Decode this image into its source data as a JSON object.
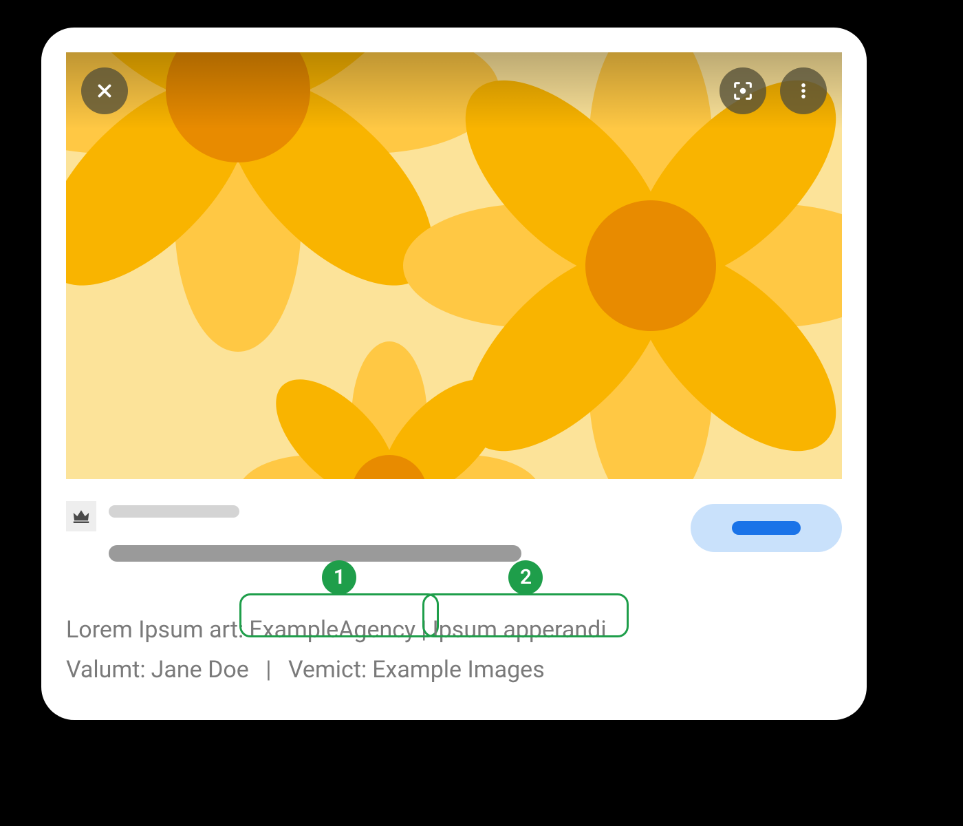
{
  "credits": {
    "line1": {
      "label": "Lorem Ipsum art:",
      "agency": "ExampleAgency",
      "separator": "|",
      "extra": "Ipsum apperandi"
    },
    "line2": {
      "creator_label": "Valumt:",
      "creator_value": "Jane Doe",
      "separator": "|",
      "credit_label": "Vemict:",
      "credit_value": "Example Images"
    }
  },
  "callouts": {
    "one": "1",
    "two": "2"
  },
  "icons": {
    "close": "close-icon",
    "lens": "lens-icon",
    "more": "more-icon",
    "crown": "crown-icon"
  }
}
